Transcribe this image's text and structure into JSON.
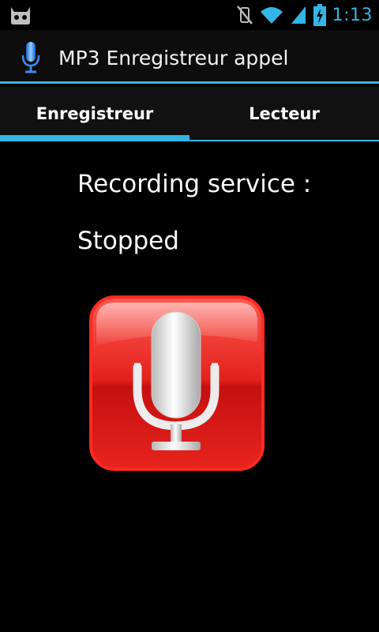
{
  "status_bar": {
    "time": "1:13"
  },
  "action_bar": {
    "title": "MP3 Enregistreur appel"
  },
  "tabs": [
    {
      "label": "Enregistreur",
      "selected": true
    },
    {
      "label": "Lecteur",
      "selected": false
    }
  ],
  "content": {
    "service_label": "Recording service :",
    "service_status": "Stopped"
  },
  "colors": {
    "accent": "#33b5e5",
    "record_red": "#d9171a"
  }
}
